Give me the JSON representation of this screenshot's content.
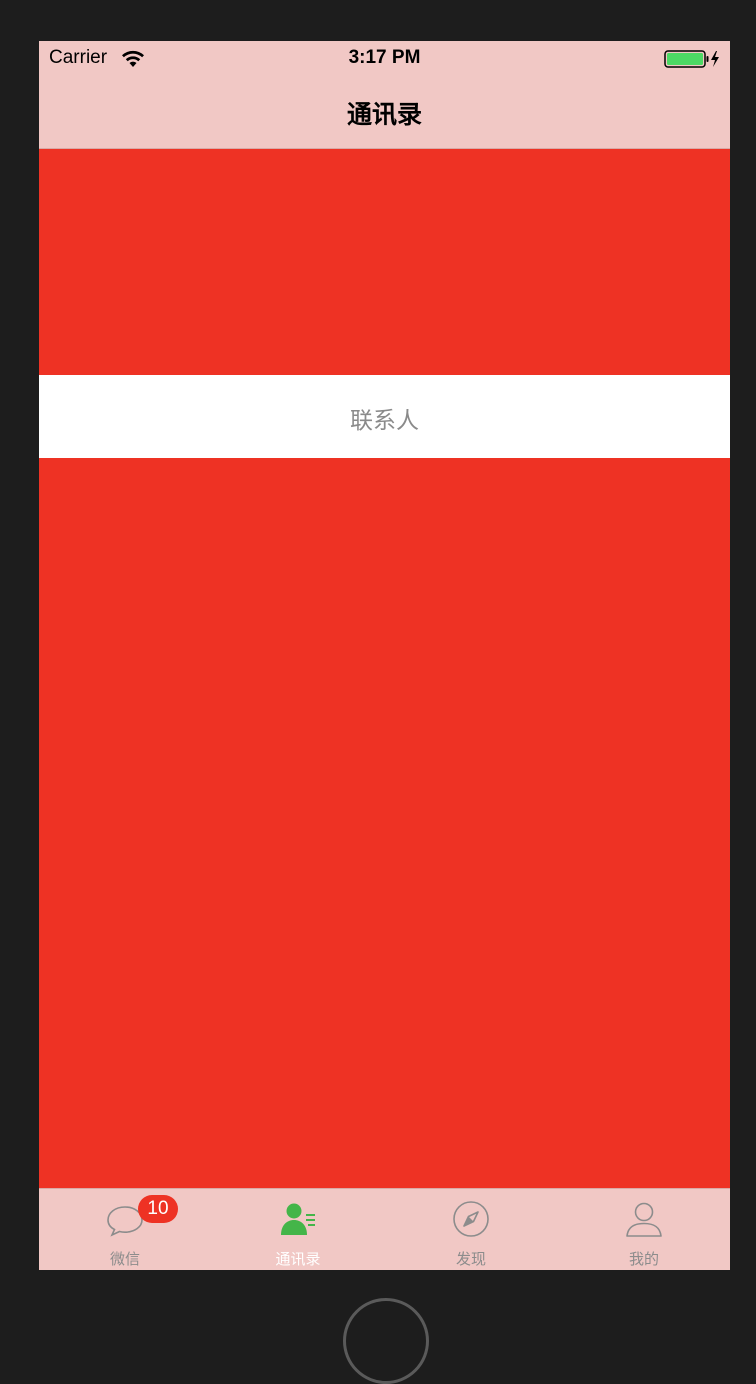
{
  "status_bar": {
    "carrier": "Carrier",
    "time": "3:17 PM",
    "battery_color": "#4cd964"
  },
  "nav_bar": {
    "title": "通讯录"
  },
  "content": {
    "contact_label": "联系人",
    "background_color": "#ee3224"
  },
  "tab_bar": {
    "tabs": [
      {
        "label": "微信",
        "icon": "chat-bubble-icon",
        "badge": "10",
        "active": false
      },
      {
        "label": "通讯录",
        "icon": "contacts-icon",
        "active": true
      },
      {
        "label": "发现",
        "icon": "compass-icon",
        "active": false
      },
      {
        "label": "我的",
        "icon": "person-icon",
        "active": false
      }
    ],
    "active_color": "#44b549",
    "inactive_color": "#8c8c8c"
  }
}
